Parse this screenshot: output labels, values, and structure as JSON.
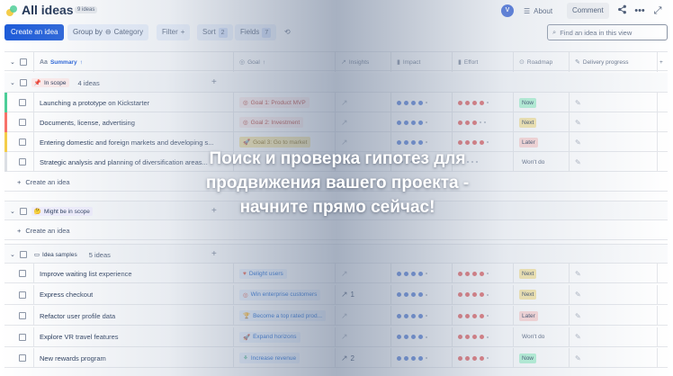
{
  "header": {
    "title": "All ideas",
    "idea_count": "9 ideas",
    "avatar_letter": "V",
    "about_label": "About",
    "comment_label": "Comment"
  },
  "toolbar": {
    "create_label": "Create an idea",
    "group_by_label": "Group by",
    "category_label": "Category",
    "filter_label": "Filter",
    "sort_label": "Sort",
    "sort_count": "2",
    "fields_label": "Fields",
    "fields_count": "7",
    "search_placeholder": "Find an idea in this view"
  },
  "columns": {
    "summary": "Summary",
    "goal": "Goal",
    "insights": "Insights",
    "impact": "Impact",
    "effort": "Effort",
    "roadmap": "Roadmap",
    "delivery": "Delivery progress"
  },
  "groups": {
    "in_scope": {
      "label": "In scope",
      "count": "4 ideas"
    },
    "might_be": {
      "label": "Might be in scope"
    },
    "samples": {
      "label": "Idea samples",
      "count": "5 ideas"
    }
  },
  "create_idea_label": "Create an idea",
  "rows": [
    {
      "summary": "Launching a prototype on Kickstarter",
      "goal": "Goal 1: Product MVP",
      "insights": "",
      "impact": 4,
      "effort": 4,
      "roadmap": "Now"
    },
    {
      "summary": "Documents, license, advertising",
      "goal": "Goal 2: Investment",
      "insights": "",
      "impact": 4,
      "effort": 3,
      "roadmap": "Next"
    },
    {
      "summary": "Entering domestic and foreign markets and developing s...",
      "goal": "Goal 3: Go to market",
      "insights": "",
      "impact": 4,
      "effort": 4,
      "roadmap": "Later"
    },
    {
      "summary": "Strategic analysis and planning of diversification areas...",
      "goal": "",
      "insights": "",
      "impact": 0,
      "effort": 0,
      "roadmap": "Won't do"
    },
    {
      "summary": "Improve waiting list experience",
      "goal": "Delight users",
      "insights": "",
      "impact": 4,
      "effort": 4,
      "roadmap": "Next"
    },
    {
      "summary": "Express checkout",
      "goal": "Win enterprise customers",
      "insights": "1",
      "impact": 4,
      "effort": 4,
      "roadmap": "Next"
    },
    {
      "summary": "Refactor user profile data",
      "goal": "Become a top rated prod...",
      "insights": "",
      "impact": 4,
      "effort": 4,
      "roadmap": "Later"
    },
    {
      "summary": "Explore VR travel features",
      "goal": "Expand horizons",
      "insights": "",
      "impact": 4,
      "effort": 4,
      "roadmap": "Won't do"
    },
    {
      "summary": "New rewards program",
      "goal": "Increase revenue",
      "insights": "2",
      "impact": 4,
      "effort": 4,
      "roadmap": "Now"
    }
  ],
  "colors": {
    "accent": "#1d5bd8",
    "impact_dot": "#4c78d6",
    "effort_dot": "#e45a5a",
    "now": "#abf5d1",
    "next": "#f8e6a0",
    "later": "#ffd5d2",
    "wont": "#e9ebee"
  },
  "banner": {
    "line1": "Поиск и проверка гипотез для",
    "line2": "продвижения вашего проекта -",
    "line3": "начните прямо сейчас!"
  }
}
